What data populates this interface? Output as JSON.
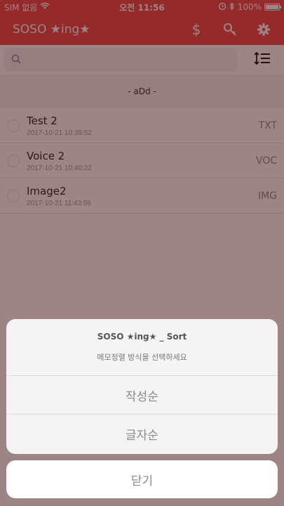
{
  "statusbar": {
    "carrier": "SIM 없음",
    "time": "오전 11:56",
    "battery": "100%",
    "battery_level": 1.0
  },
  "navbar": {
    "title": "SOSO ★ing★"
  },
  "search": {
    "placeholder": ""
  },
  "section": {
    "label": "- aDd -"
  },
  "list": [
    {
      "name": "Test 2",
      "date": "2017-10-21 10:39:52",
      "type": "TXT"
    },
    {
      "name": "Voice 2",
      "date": "2017-10-21 10:40:22",
      "type": "VOC"
    },
    {
      "name": "Image2",
      "date": "2017-10-21 11:43:56",
      "type": "IMG"
    }
  ],
  "sheet": {
    "title": "SOSO ★ing★ _ Sort",
    "message": "메모정렬 방식을 선택하세요",
    "options": [
      "작성순",
      "글자순"
    ],
    "cancel": "닫기"
  },
  "icons": {
    "wifi": "wifi-icon",
    "alarm": "alarm-icon",
    "bluetooth": "bluetooth-icon",
    "dollar": "dollar-icon",
    "key": "key-icon",
    "settings": "gear-icon",
    "search": "search-icon",
    "sort": "sort-icon"
  },
  "colors": {
    "accent": "#ef4a4b"
  }
}
